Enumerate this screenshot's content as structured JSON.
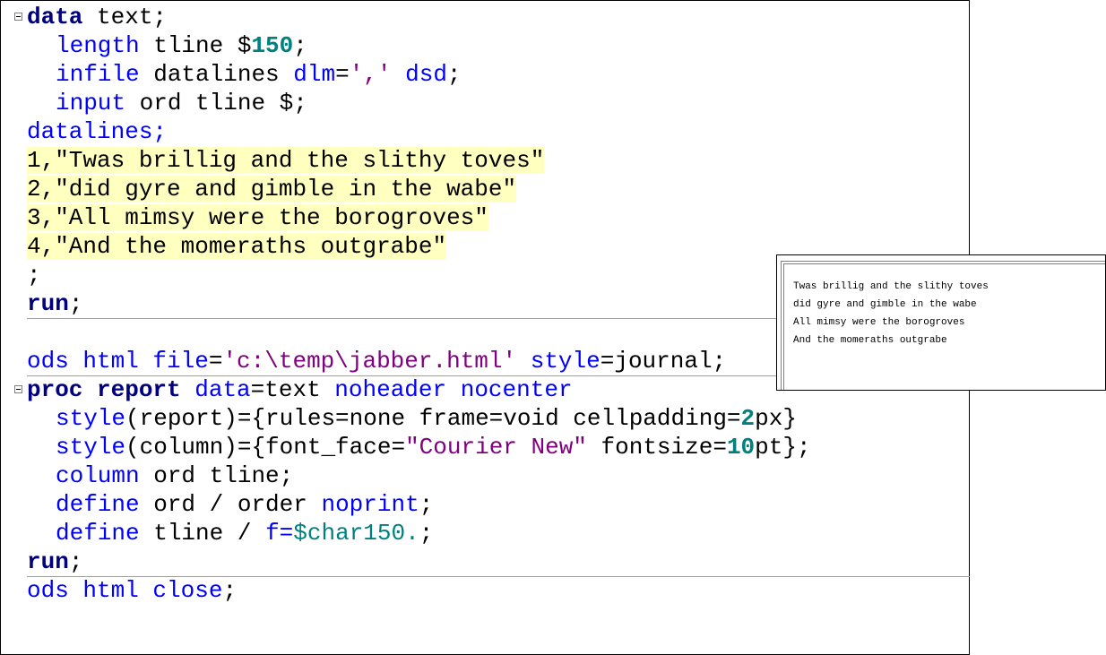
{
  "code": {
    "lines": [
      {
        "indent": false,
        "fold": true,
        "tokens": [
          {
            "t": "data",
            "c": "kw"
          },
          {
            "t": " text;",
            "c": ""
          }
        ]
      },
      {
        "indent": true,
        "tokens": [
          {
            "t": "length",
            "c": "bl"
          },
          {
            "t": " tline $",
            "c": ""
          },
          {
            "t": "150",
            "c": "num"
          },
          {
            "t": ";",
            "c": ""
          }
        ]
      },
      {
        "indent": true,
        "tokens": [
          {
            "t": "infile",
            "c": "bl"
          },
          {
            "t": " datalines ",
            "c": ""
          },
          {
            "t": "dlm",
            "c": "bl"
          },
          {
            "t": "=",
            "c": ""
          },
          {
            "t": "','",
            "c": "str"
          },
          {
            "t": " ",
            "c": ""
          },
          {
            "t": "dsd",
            "c": "bl"
          },
          {
            "t": ";",
            "c": ""
          }
        ]
      },
      {
        "indent": true,
        "tokens": [
          {
            "t": "input",
            "c": "bl"
          },
          {
            "t": " ord tline $;",
            "c": ""
          }
        ]
      },
      {
        "indent": false,
        "tokens": [
          {
            "t": "datalines;",
            "c": "bl"
          }
        ]
      },
      {
        "indent": false,
        "tokens": [
          {
            "t": "1,\"Twas brillig and the slithy toves\"",
            "c": "hl"
          }
        ]
      },
      {
        "indent": false,
        "tokens": [
          {
            "t": "2,\"did gyre and gimble in the wabe\"",
            "c": "hl"
          }
        ]
      },
      {
        "indent": false,
        "tokens": [
          {
            "t": "3,\"All mimsy were the borogroves\"",
            "c": "hl"
          }
        ]
      },
      {
        "indent": false,
        "tokens": [
          {
            "t": "4,\"And the momeraths outgrabe\"",
            "c": "hl"
          }
        ]
      },
      {
        "indent": false,
        "tokens": [
          {
            "t": ";",
            "c": ""
          }
        ]
      },
      {
        "indent": false,
        "sep": true,
        "tokens": [
          {
            "t": "run",
            "c": "kw"
          },
          {
            "t": ";",
            "c": ""
          }
        ]
      },
      {
        "indent": false,
        "tokens": []
      },
      {
        "indent": false,
        "sep": true,
        "tokens": [
          {
            "t": "ods html file",
            "c": "bl"
          },
          {
            "t": "=",
            "c": ""
          },
          {
            "t": "'c:\\temp\\jabber.html'",
            "c": "str"
          },
          {
            "t": " ",
            "c": ""
          },
          {
            "t": "style",
            "c": "bl"
          },
          {
            "t": "=journal;",
            "c": ""
          }
        ]
      },
      {
        "indent": false,
        "fold": true,
        "tokens": [
          {
            "t": "proc report",
            "c": "kw"
          },
          {
            "t": " ",
            "c": ""
          },
          {
            "t": "data",
            "c": "bl"
          },
          {
            "t": "=text ",
            "c": ""
          },
          {
            "t": "noheader nocenter",
            "c": "bl"
          }
        ]
      },
      {
        "indent": true,
        "tokens": [
          {
            "t": "style",
            "c": "bl"
          },
          {
            "t": "(report)={rules=none frame=void cellpadding=",
            "c": ""
          },
          {
            "t": "2",
            "c": "num"
          },
          {
            "t": "px}",
            "c": ""
          }
        ]
      },
      {
        "indent": true,
        "tokens": [
          {
            "t": "style",
            "c": "bl"
          },
          {
            "t": "(column)={font_face=",
            "c": ""
          },
          {
            "t": "\"Courier New\"",
            "c": "str"
          },
          {
            "t": " fontsize=",
            "c": ""
          },
          {
            "t": "10",
            "c": "num"
          },
          {
            "t": "pt};",
            "c": ""
          }
        ]
      },
      {
        "indent": true,
        "tokens": [
          {
            "t": "column",
            "c": "bl"
          },
          {
            "t": " ord tline;",
            "c": ""
          }
        ]
      },
      {
        "indent": true,
        "tokens": [
          {
            "t": "define",
            "c": "bl"
          },
          {
            "t": " ord / order ",
            "c": ""
          },
          {
            "t": "noprint",
            "c": "bl"
          },
          {
            "t": ";",
            "c": ""
          }
        ]
      },
      {
        "indent": true,
        "tokens": [
          {
            "t": "define",
            "c": "bl"
          },
          {
            "t": " tline / ",
            "c": ""
          },
          {
            "t": "f=",
            "c": "bl"
          },
          {
            "t": "$char150.",
            "c": "fmt"
          },
          {
            "t": ";",
            "c": ""
          }
        ]
      },
      {
        "indent": false,
        "sep": true,
        "tokens": [
          {
            "t": "run",
            "c": "kw"
          },
          {
            "t": ";",
            "c": ""
          }
        ]
      },
      {
        "indent": false,
        "tokens": [
          {
            "t": "ods html close",
            "c": "bl"
          },
          {
            "t": ";",
            "c": ""
          }
        ]
      }
    ]
  },
  "output": {
    "lines": [
      "Twas brillig and the slithy toves",
      "did gyre and gimble in the wabe",
      "All mimsy were the borogroves",
      "And the momeraths outgrabe"
    ]
  }
}
